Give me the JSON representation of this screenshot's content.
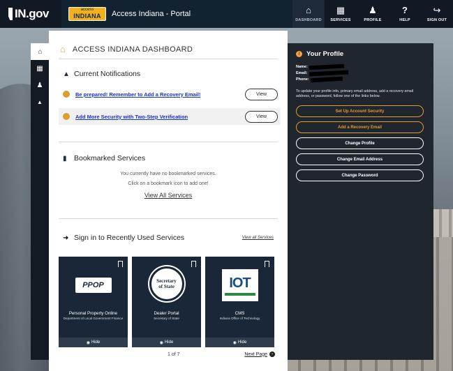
{
  "brand": {
    "logo_text": "IN.gov"
  },
  "portal": {
    "logo_small": "access",
    "logo_big": "INDIANA",
    "title": "Access Indiana - Portal"
  },
  "nav": [
    {
      "label": "DASHBOARD",
      "icon": "home-icon",
      "glyph": "⌂"
    },
    {
      "label": "SERVICES",
      "icon": "grid-icon",
      "glyph": "▦"
    },
    {
      "label": "PROFILE",
      "icon": "user-icon",
      "glyph": "♟"
    },
    {
      "label": "HELP",
      "icon": "help-icon",
      "glyph": "?"
    },
    {
      "label": "SIGN OUT",
      "icon": "sign-out-icon",
      "glyph": "↪"
    }
  ],
  "rail": [
    {
      "icon": "home-icon",
      "glyph": "⌂"
    },
    {
      "icon": "grid-icon",
      "glyph": "▦"
    },
    {
      "icon": "user-icon",
      "glyph": "♟"
    },
    {
      "icon": "bell-icon",
      "glyph": "▲"
    }
  ],
  "dashboard": {
    "title": "ACCESS INDIANA DASHBOARD",
    "notifications": {
      "title": "Current Notifications",
      "items": [
        {
          "text": "Be prepared! Remember to Add a Recovery Email!",
          "button": "View"
        },
        {
          "text": "Add More Security with Two-Step Verification",
          "button": "View"
        }
      ]
    },
    "bookmarks": {
      "title": "Bookmarked Services",
      "empty_line1": "You currently have no bookmarked services.",
      "empty_line2": "Click on a bookmark icon to add one!",
      "view_all": "View All Services"
    },
    "recent": {
      "title": "Sign in to Recently Used Services",
      "view_all": "View all Services",
      "cards": [
        {
          "name": "Personal Property Online",
          "sub": "Department of Local Government Finance",
          "logo": "PPOP",
          "hide": "Hide"
        },
        {
          "name": "Dealer Portal",
          "sub": "Secretary of State",
          "logo": "Secretary of State",
          "hide": "Hide"
        },
        {
          "name": "CMS",
          "sub": "Indiana Office of Technology",
          "logo": "IOT",
          "hide": "Hide"
        }
      ],
      "page": "1 of 7",
      "next": "Next Page"
    }
  },
  "profile": {
    "title": "Your Profile",
    "name_label": "Name:",
    "email_label": "Email:",
    "phone_label": "Phone:",
    "description": "To update your profile info, primary email address, add a recovery email address, or password, follow one of the links below.",
    "buttons": {
      "security": "Set Up Account Security",
      "recovery": "Add a Recovery Email",
      "change_profile": "Change Profile",
      "change_email": "Change Email Address",
      "change_password": "Change Password"
    }
  },
  "colors": {
    "topbar": "#111a24",
    "accent_orange": "#e19a2d",
    "link_blue": "#1a33c8",
    "panel_dark": "#20262d",
    "card_navy": "#1a2738"
  }
}
